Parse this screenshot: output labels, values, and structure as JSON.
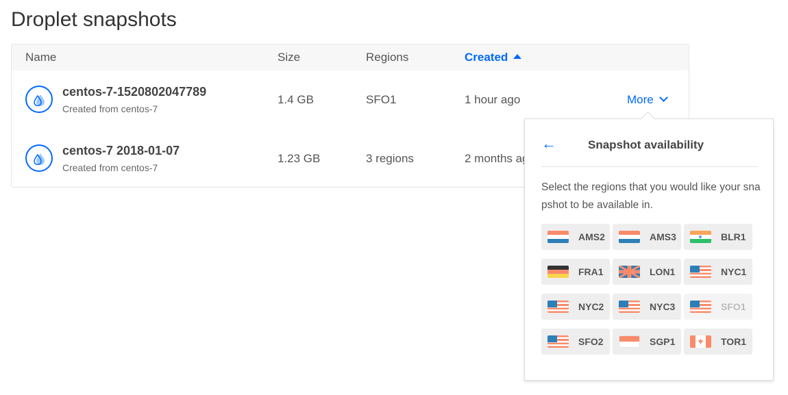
{
  "page_title": "Droplet snapshots",
  "table": {
    "headers": {
      "name": "Name",
      "size": "Size",
      "regions": "Regions",
      "created": "Created"
    },
    "sort": {
      "column": "created",
      "direction": "ascending"
    },
    "rows": [
      {
        "name": "centos-7-1520802047789",
        "subtitle": "Created from centos-7",
        "size": "1.4 GB",
        "regions": "SFO1",
        "created": "1 hour ago",
        "action": "More"
      },
      {
        "name": "centos-7 2018-01-07",
        "subtitle": "Created from centos-7",
        "size": "1.23 GB",
        "regions": "3 regions",
        "created": "2 months ago"
      }
    ]
  },
  "popover": {
    "back_icon": "arrow-left-icon",
    "title": "Snapshot availability",
    "description": "Select the regions that you would like your snapshot to be available in.",
    "regions": [
      {
        "code": "AMS2",
        "flag": "netherlands",
        "disabled": false
      },
      {
        "code": "AMS3",
        "flag": "netherlands",
        "disabled": false
      },
      {
        "code": "BLR1",
        "flag": "india",
        "disabled": false
      },
      {
        "code": "FRA1",
        "flag": "germany",
        "disabled": false
      },
      {
        "code": "LON1",
        "flag": "united-kingdom",
        "disabled": false
      },
      {
        "code": "NYC1",
        "flag": "united-states",
        "disabled": false
      },
      {
        "code": "NYC2",
        "flag": "united-states",
        "disabled": false
      },
      {
        "code": "NYC3",
        "flag": "united-states",
        "disabled": false
      },
      {
        "code": "SFO1",
        "flag": "united-states",
        "disabled": true
      },
      {
        "code": "SFO2",
        "flag": "united-states",
        "disabled": false
      },
      {
        "code": "SGP1",
        "flag": "singapore",
        "disabled": false
      },
      {
        "code": "TOR1",
        "flag": "canada",
        "disabled": false
      }
    ]
  },
  "colors": {
    "accent": "#0069ff"
  }
}
